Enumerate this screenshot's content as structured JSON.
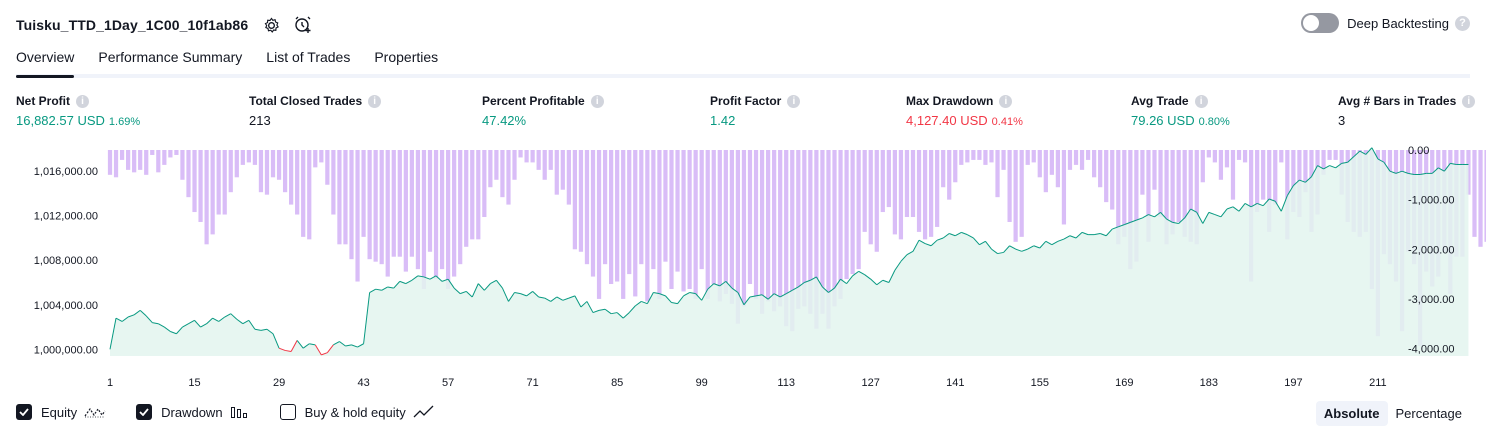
{
  "header": {
    "strategy_name": "Tuisku_TTD_1Day_1C00_10f1ab86",
    "settings_icon": "gear-icon",
    "add_alert_icon": "add-alert-icon",
    "deep_backtesting_label": "Deep Backtesting",
    "deep_backtesting_on": false,
    "help_icon": "question-icon"
  },
  "tabs": [
    "Overview",
    "Performance Summary",
    "List of Trades",
    "Properties"
  ],
  "active_tab": "Overview",
  "stats": {
    "net_profit": {
      "label": "Net Profit",
      "value": "16,882.57 USD",
      "pct": "1.69%"
    },
    "total_closed_trades": {
      "label": "Total Closed Trades",
      "value": "213"
    },
    "percent_profitable": {
      "label": "Percent Profitable",
      "value": "47.42%"
    },
    "profit_factor": {
      "label": "Profit Factor",
      "value": "1.42"
    },
    "max_drawdown": {
      "label": "Max Drawdown",
      "value": "4,127.40 USD",
      "pct": "0.41%"
    },
    "avg_trade": {
      "label": "Avg Trade",
      "value": "79.26 USD",
      "pct": "0.80%"
    },
    "avg_bars": {
      "label": "Avg # Bars in Trades",
      "value": "3"
    }
  },
  "colors": {
    "positive": "#089981",
    "negative": "#f23645",
    "equity_line": "#089981",
    "equity_fill": "#e3f4ee",
    "drawdown_bar": "#d9bdf7"
  },
  "chart_data": {
    "type": "area",
    "series": [
      {
        "name": "Equity",
        "axis": "left",
        "values": [
          1000000,
          1002800,
          1002500,
          1002900,
          1003100,
          1003500,
          1003000,
          1002400,
          1002300,
          1002000,
          1001600,
          1001400,
          1002000,
          1002300,
          1002600,
          1002000,
          1002300,
          1002800,
          1002500,
          1002900,
          1003200,
          1002700,
          1002300,
          1002600,
          1001800,
          1001700,
          1001800,
          1001400,
          1000100,
          999900,
          999800,
          1000800,
          1000100,
          1000500,
          1000400,
          999500,
          999700,
          1000400,
          1000700,
          1000300,
          1000400,
          1000200,
          1000500,
          1005100,
          1005400,
          1005300,
          1005600,
          1005500,
          1006100,
          1005900,
          1006200,
          1006600,
          1006500,
          1006300,
          1006600,
          1006100,
          1006300,
          1005500,
          1005000,
          1005200,
          1004700,
          1005900,
          1005300,
          1005900,
          1006200,
          1005500,
          1004300,
          1005100,
          1005000,
          1004800,
          1005200,
          1004700,
          1004600,
          1004300,
          1004700,
          1004400,
          1004600,
          1004800,
          1003800,
          1004300,
          1003300,
          1003500,
          1003600,
          1003200,
          1003300,
          1002800,
          1003300,
          1003900,
          1004300,
          1004100,
          1005100,
          1005000,
          1004800,
          1004200,
          1004100,
          1004800,
          1005100,
          1005000,
          1004400,
          1005400,
          1005900,
          1005700,
          1006100,
          1005500,
          1005100,
          1004000,
          1004700,
          1004800,
          1004900,
          1004500,
          1005000,
          1004700,
          1005000,
          1005300,
          1005600,
          1006000,
          1006200,
          1006500,
          1005600,
          1005100,
          1005500,
          1006300,
          1005900,
          1006600,
          1007000,
          1006700,
          1006300,
          1005800,
          1006200,
          1006000,
          1007100,
          1007900,
          1008500,
          1008800,
          1009800,
          1009500,
          1009300,
          1009800,
          1010000,
          1010400,
          1010200,
          1010500,
          1010300,
          1010000,
          1009400,
          1009700,
          1009000,
          1008600,
          1008700,
          1009300,
          1009000,
          1008800,
          1009000,
          1009300,
          1009100,
          1009700,
          1009400,
          1009700,
          1009900,
          1010200,
          1010000,
          1010500,
          1010300,
          1010300,
          1010400,
          1010200,
          1010800,
          1011000,
          1011200,
          1011400,
          1011600,
          1011800,
          1012100,
          1011900,
          1012300,
          1011700,
          1011400,
          1011300,
          1011800,
          1012600,
          1012300,
          1011300,
          1012300,
          1012100,
          1011900,
          1012600,
          1012800,
          1012400,
          1013100,
          1012800,
          1013100,
          1012900,
          1013500,
          1013300,
          1012400,
          1013800,
          1014700,
          1015200,
          1015000,
          1015500,
          1016500,
          1016200,
          1016500,
          1016300,
          1016700,
          1016800,
          1017300,
          1017800,
          1017500,
          1018100,
          1017100,
          1016800,
          1016000,
          1015800,
          1016000,
          1015800,
          1015700,
          1015700,
          1015800,
          1015800,
          1016300,
          1016000,
          1016700,
          1016600,
          1016600,
          1016600
        ]
      },
      {
        "name": "Drawdown",
        "axis": "right",
        "values": [
          -500,
          -550,
          -200,
          -400,
          -450,
          -400,
          -500,
          -100,
          -450,
          -300,
          -150,
          -100,
          -600,
          -950,
          -1250,
          -1450,
          -1900,
          -1700,
          -1300,
          -1300,
          -850,
          -550,
          -300,
          -250,
          -300,
          -850,
          -900,
          -550,
          -600,
          -850,
          -1100,
          -1300,
          -1750,
          -1800,
          -350,
          -250,
          -700,
          -1300,
          -1900,
          -1900,
          -2200,
          -2650,
          -1750,
          -2200,
          -2250,
          -2300,
          -2550,
          -2150,
          -2150,
          -2450,
          -2150,
          -2400,
          -2800,
          -2050,
          -2600,
          -2400,
          -2800,
          -2550,
          -2300,
          -1950,
          -1800,
          -1800,
          -1350,
          -750,
          -600,
          -950,
          -1100,
          -600,
          -150,
          -250,
          -250,
          -400,
          -600,
          -400,
          -900,
          -800,
          -1100,
          -2000,
          -2050,
          -2300,
          -2550,
          -3000,
          -2300,
          -2700,
          -2650,
          -3000,
          -2500,
          -2950,
          -2300,
          -3050,
          -2400,
          -3000,
          -2250,
          -2800,
          -2450,
          -2850,
          -2800,
          -3000,
          -2400,
          -3000,
          -2700,
          -3050,
          -2900,
          -3100,
          -3500,
          -3150,
          -2700,
          -3000,
          -3300,
          -3050,
          -3250,
          -3150,
          -3550,
          -3650,
          -3200,
          -3150,
          -3300,
          -3600,
          -3300,
          -3600,
          -3150,
          -3000,
          -2600,
          -2500,
          -2400,
          -1650,
          -1900,
          -2050,
          -1250,
          -1150,
          -1700,
          -1800,
          -1350,
          -1350,
          -1650,
          -1800,
          -1750,
          -1550,
          -750,
          -1000,
          -650,
          -300,
          -250,
          -200,
          -200,
          -300,
          -250,
          -950,
          -400,
          -1450,
          -1850,
          -1750,
          -300,
          -250,
          -550,
          -850,
          -500,
          -750,
          -1500,
          -400,
          -300,
          -400,
          -200,
          -550,
          -750,
          -1050,
          -1200,
          -1900,
          -1750,
          -2400,
          -2250,
          -900,
          -1850,
          -800,
          -1350,
          -1900,
          -1700,
          -1450,
          -1750,
          -1850,
          -1900,
          -650,
          -150,
          -250,
          -600,
          -350,
          -1000,
          -200,
          -250,
          -2650,
          -1250,
          -1000,
          -1650,
          -1100,
          -250,
          -1800,
          -1250,
          -1350,
          -850,
          -1650,
          -1300,
          -500,
          -200,
          -200,
          -900,
          -1450,
          -1650,
          -1750,
          -1650,
          -2800,
          -3750,
          -2100,
          -2300,
          -2650,
          -3650,
          -2050,
          -2300,
          -3950,
          -2450,
          -2750,
          -2550,
          -2050,
          -2900,
          -2150,
          -2150,
          -900,
          -1750,
          -1950,
          -1850,
          -2050,
          -1900,
          -1800,
          -1100,
          -2050
        ]
      }
    ],
    "x_ticks": [
      "1",
      "15",
      "29",
      "43",
      "57",
      "71",
      "85",
      "99",
      "113",
      "127",
      "141",
      "155",
      "169",
      "183",
      "197",
      "211"
    ],
    "left_ticks": [
      "1,016,000.00",
      "1,012,000.00",
      "1,008,000.00",
      "1,004,000.00",
      "1,000,000.00"
    ],
    "right_ticks": [
      "0.00",
      "-1,000.00",
      "-2,000.00",
      "-3,000.00",
      "-4,000.00"
    ],
    "left_range": [
      999400,
      1017900
    ],
    "right_range": [
      -4150,
      0
    ],
    "x_range": [
      1,
      214
    ]
  },
  "legend": {
    "equity": {
      "label": "Equity",
      "checked": true,
      "icon": "equity-line-icon"
    },
    "drawdown": {
      "label": "Drawdown",
      "checked": true,
      "icon": "drawdown-bars-icon"
    },
    "buy_hold": {
      "label": "Buy & hold equity",
      "checked": false,
      "icon": "buy-hold-line-icon"
    }
  },
  "modes": [
    "Absolute",
    "Percentage"
  ],
  "active_mode": "Absolute"
}
